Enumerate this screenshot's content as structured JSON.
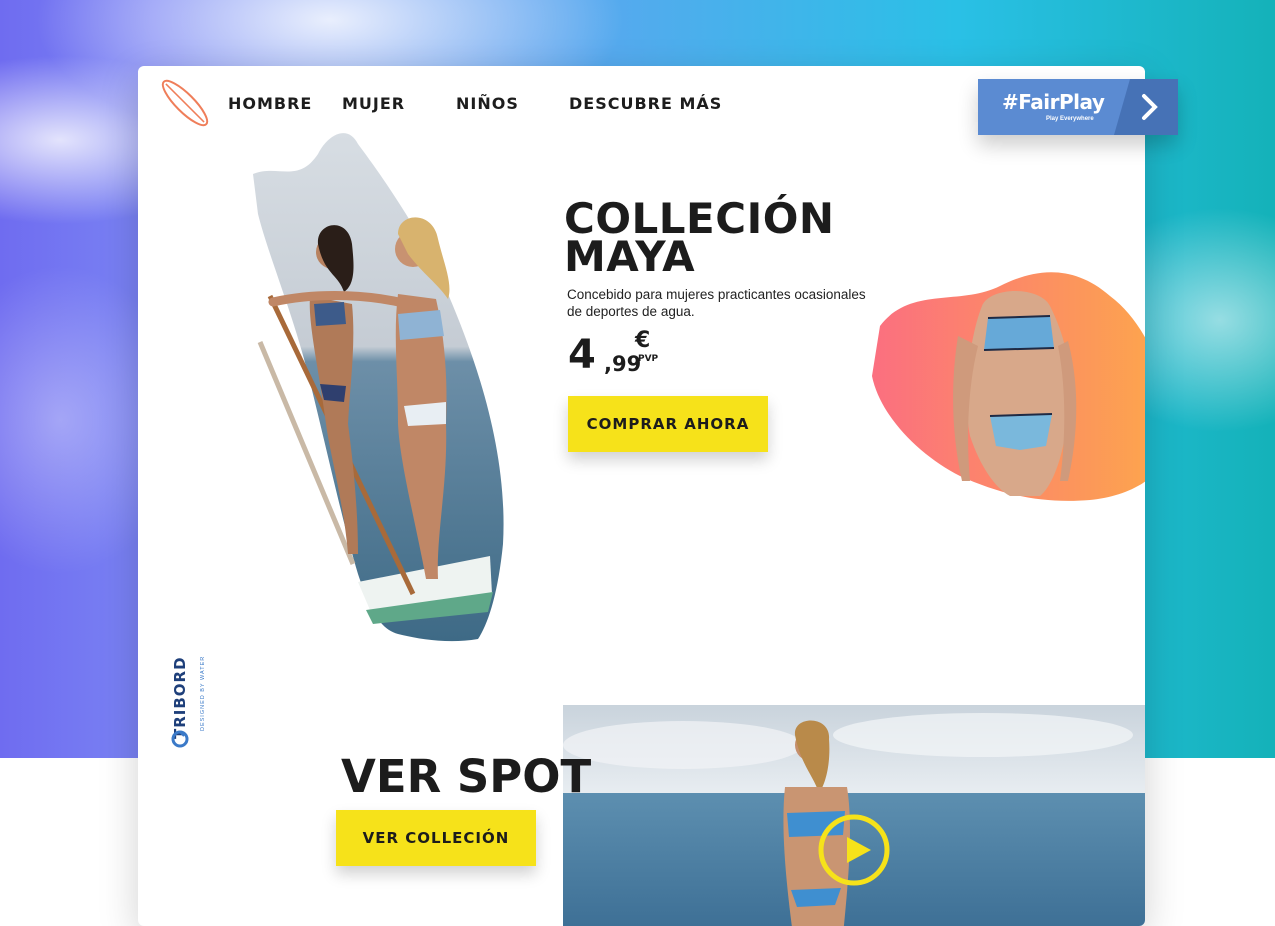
{
  "nav": {
    "items": [
      "HOMBRE",
      "MUJER",
      "NIÑOS",
      "DESCUBRE MÁS"
    ]
  },
  "hero": {
    "title_line1": "COLLECIÓN",
    "title_line2": "MAYA",
    "description": "Concebido para mujeres practicantes ocasionales de deportes de agua.",
    "price_int": "4",
    "price_dec": ",99",
    "price_currency": "€",
    "price_pvp": "PVP",
    "buy_label": "COMPRAR AHORA"
  },
  "fairplay": {
    "label": "#FairPlay",
    "sub": "Play Everywhere"
  },
  "brand": {
    "name": "TRIBORD",
    "tagline": "DESIGNED BY WATER"
  },
  "spot": {
    "title": "VER SPOT",
    "collection_label": "VER COLLECIÓN"
  },
  "colors": {
    "accent_yellow": "#f6e21a",
    "fairplay_blue": "#5b8bd2",
    "brand_blue": "#1e3f7a",
    "text_dark": "#1c1c1c"
  }
}
